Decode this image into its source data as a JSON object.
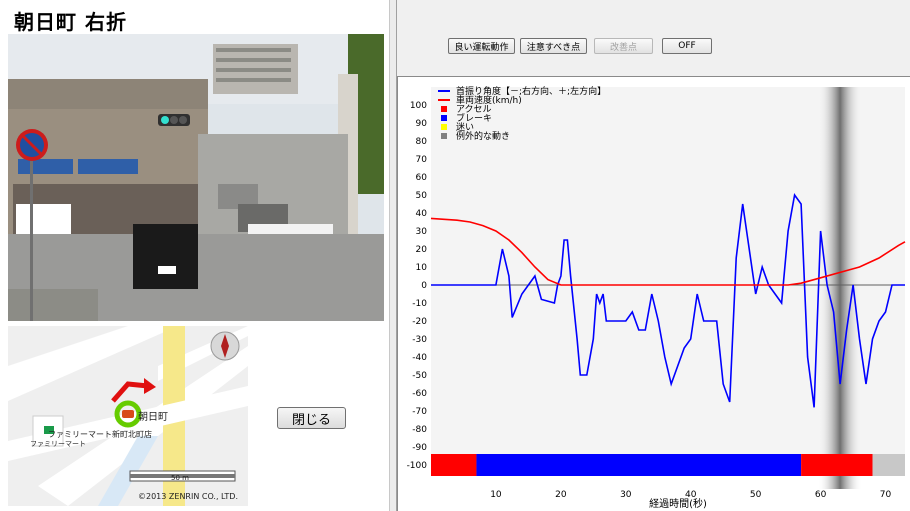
{
  "title": "朝日町 右折",
  "map": {
    "place_label": "朝日町",
    "store_label": "ファミリーマート新町北町店",
    "store_sub_label": "ファミリーマート",
    "scale_label": "50 m",
    "copyright": "©2013 ZENRIN CO., LTD."
  },
  "close_button_label": "閉じる",
  "toolbar": {
    "good_driving_label": "良い運転動作",
    "caution_label": "注意すべき点",
    "improvement_label": "改善点",
    "off_label": "OFF"
  },
  "chart_data": {
    "type": "line",
    "xlabel": "経過時間(秒)",
    "ylabel": "",
    "xlim": [
      0,
      73
    ],
    "ylim": [
      -100,
      110
    ],
    "x_ticks": [
      10,
      20,
      30,
      40,
      50,
      60,
      70
    ],
    "y_ticks": [
      100,
      90,
      80,
      70,
      60,
      50,
      40,
      30,
      20,
      10,
      0,
      -10,
      -20,
      -30,
      -40,
      -50,
      -60,
      -70,
      -80,
      -90,
      -100
    ],
    "legend": [
      {
        "name": "首振り角度【－;右方向、＋;左方向】",
        "color": "#0000ff",
        "kind": "line"
      },
      {
        "name": "車両速度(km/h)",
        "color": "#ff0000",
        "kind": "line"
      },
      {
        "name": "アクセル",
        "color": "#ff0000",
        "kind": "square"
      },
      {
        "name": "ブレーキ",
        "color": "#0000ff",
        "kind": "square"
      },
      {
        "name": "迷い",
        "color": "#ffff00",
        "kind": "square"
      },
      {
        "name": "例外的な動き",
        "color": "#808080",
        "kind": "square"
      }
    ],
    "series": [
      {
        "name": "首振り角度【－;右方向、＋;左方向】",
        "color": "#0000ff",
        "x": [
          0,
          10,
          11,
          12,
          12.5,
          14,
          16,
          17,
          19,
          19.5,
          20,
          20.5,
          21,
          21.5,
          22.5,
          23,
          24,
          25,
          25.5,
          26,
          26.5,
          27,
          28,
          30,
          31,
          32,
          33,
          34,
          35,
          36,
          37,
          38,
          39,
          40,
          41,
          42,
          43,
          44,
          45,
          46,
          47,
          48,
          49,
          50,
          51,
          52,
          53,
          54,
          55,
          56,
          57,
          58,
          59,
          60,
          61,
          62,
          63,
          64,
          65,
          66,
          67,
          68,
          69,
          70,
          71,
          72,
          73
        ],
        "y": [
          0,
          0,
          20,
          5,
          -18,
          -5,
          5,
          -8,
          -10,
          0,
          5,
          25,
          25,
          5,
          -30,
          -50,
          -50,
          -30,
          -5,
          -10,
          -5,
          -20,
          -20,
          -20,
          -15,
          -25,
          -25,
          -5,
          -20,
          -40,
          -55,
          -45,
          -35,
          -30,
          -5,
          -20,
          -20,
          -20,
          -55,
          -65,
          15,
          45,
          20,
          -5,
          10,
          0,
          -5,
          -10,
          30,
          50,
          45,
          -40,
          -68,
          30,
          0,
          -15,
          -55,
          -25,
          0,
          -30,
          -55,
          -30,
          -20,
          -15,
          0,
          0,
          0
        ]
      },
      {
        "name": "車両速度(km/h)",
        "color": "#ff0000",
        "x": [
          0,
          2,
          4,
          6,
          8,
          10,
          12,
          14,
          16,
          18,
          20,
          22,
          24,
          26,
          30,
          35,
          40,
          45,
          50,
          55,
          57,
          60,
          63,
          66,
          69,
          72,
          73
        ],
        "y": [
          37,
          36.5,
          36,
          35,
          33,
          30,
          25,
          18,
          10,
          3,
          0,
          0,
          0,
          0,
          0,
          0,
          0,
          0,
          0,
          0,
          1,
          4,
          7,
          10,
          15,
          22,
          24
        ]
      }
    ],
    "bottom_band": [
      {
        "from": 0,
        "to": 7,
        "color": "#ff0000"
      },
      {
        "from": 7,
        "to": 57,
        "color": "#0000ff"
      },
      {
        "from": 57,
        "to": 68,
        "color": "#ff0000"
      },
      {
        "from": 68,
        "to": 73,
        "color": "#c8c8c8"
      }
    ],
    "highlight_x": 63
  }
}
